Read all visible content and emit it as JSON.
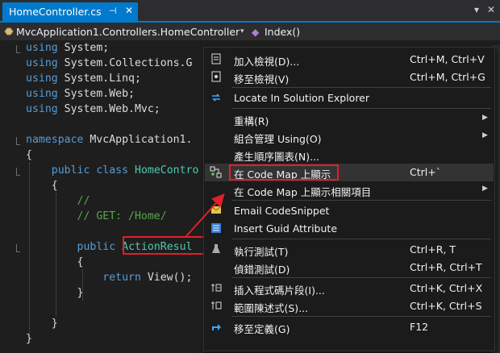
{
  "tab": {
    "title": "HomeController.cs",
    "pin": "⊣",
    "close": "✕"
  },
  "window_controls": {
    "dropdown": "▾",
    "close": "✕"
  },
  "navbar": {
    "class_path": "MvcApplication1.Controllers.HomeController",
    "member": "Index()",
    "dropdown": "▾"
  },
  "code_lines": [
    {
      "parts": [
        [
          "kw",
          "using"
        ],
        [
          "t",
          " System;"
        ]
      ]
    },
    {
      "parts": [
        [
          "kw",
          "using"
        ],
        [
          "t",
          " System.Collections.G"
        ]
      ]
    },
    {
      "parts": [
        [
          "kw",
          "using"
        ],
        [
          "t",
          " System.Linq;"
        ]
      ]
    },
    {
      "parts": [
        [
          "kw",
          "using"
        ],
        [
          "t",
          " System.Web;"
        ]
      ]
    },
    {
      "parts": [
        [
          "kw",
          "using"
        ],
        [
          "t",
          " System.Web.Mvc;"
        ]
      ]
    },
    {
      "parts": []
    },
    {
      "parts": [
        [
          "kw",
          "namespace"
        ],
        [
          "t",
          " MvcApplication1."
        ]
      ]
    },
    {
      "parts": [
        [
          "t",
          "{"
        ]
      ]
    },
    {
      "parts": [
        [
          "t",
          "    "
        ],
        [
          "kw",
          "public"
        ],
        [
          "t",
          " "
        ],
        [
          "kw",
          "class"
        ],
        [
          "t",
          " "
        ],
        [
          "ty",
          "HomeContro"
        ]
      ]
    },
    {
      "parts": [
        [
          "t",
          "    {"
        ]
      ]
    },
    {
      "parts": [
        [
          "t",
          "        "
        ],
        [
          "cm",
          "//"
        ]
      ]
    },
    {
      "parts": [
        [
          "t",
          "        "
        ],
        [
          "cm",
          "// GET: /Home/"
        ]
      ]
    },
    {
      "parts": []
    },
    {
      "parts": [
        [
          "t",
          "        "
        ],
        [
          "kw",
          "public"
        ],
        [
          "t",
          " "
        ],
        [
          "ty",
          "ActionResul"
        ]
      ]
    },
    {
      "parts": [
        [
          "t",
          "        {"
        ]
      ]
    },
    {
      "parts": [
        [
          "t",
          "            "
        ],
        [
          "kw",
          "return"
        ],
        [
          "t",
          " View();"
        ]
      ]
    },
    {
      "parts": [
        [
          "t",
          "        }"
        ]
      ]
    },
    {
      "parts": []
    },
    {
      "parts": [
        [
          "t",
          "    }"
        ]
      ]
    },
    {
      "parts": [
        [
          "t",
          "}"
        ]
      ]
    }
  ],
  "colors": {
    "keyword": "#569cd6",
    "type": "#4ec9b0",
    "comment": "#57a64a",
    "accent": "#007acc",
    "highlight": "#e0202a"
  },
  "menu": {
    "items": [
      {
        "icon": "add-view-icon",
        "label": "加入檢視(D)...",
        "shortcut": "Ctrl+M, Ctrl+V",
        "submenu": false
      },
      {
        "icon": "goto-view-icon",
        "label": "移至檢視(V)",
        "shortcut": "Ctrl+M, Ctrl+G",
        "submenu": false
      },
      {
        "separator": true
      },
      {
        "icon": "locate-solution-icon",
        "label": "Locate In Solution Explorer",
        "shortcut": "",
        "submenu": false
      },
      {
        "separator": true
      },
      {
        "icon": "",
        "label": "重構(R)",
        "shortcut": "",
        "submenu": true
      },
      {
        "icon": "",
        "label": "組合管理 Using(O)",
        "shortcut": "",
        "submenu": true
      },
      {
        "icon": "",
        "label": "產生順序圖表(N)...",
        "shortcut": "",
        "submenu": false
      },
      {
        "icon": "code-map-icon",
        "label": "在 Code Map 上顯示",
        "shortcut": "Ctrl+`",
        "submenu": false,
        "active": true
      },
      {
        "icon": "",
        "label": "在 Code Map 上顯示相關項目",
        "shortcut": "",
        "submenu": true
      },
      {
        "separator": true
      },
      {
        "icon": "email-icon",
        "label": "Email CodeSnippet",
        "shortcut": "",
        "submenu": false
      },
      {
        "icon": "guid-icon",
        "label": "Insert Guid Attribute",
        "shortcut": "",
        "submenu": false
      },
      {
        "separator": true
      },
      {
        "icon": "run-tests-icon",
        "label": "執行測試(T)",
        "shortcut": "Ctrl+R, T",
        "submenu": false
      },
      {
        "icon": "",
        "label": "偵錯測試(D)",
        "shortcut": "Ctrl+R, Ctrl+T",
        "submenu": false
      },
      {
        "separator": true
      },
      {
        "icon": "insert-snippet-icon",
        "label": "插入程式碼片段(I)...",
        "shortcut": "Ctrl+K, Ctrl+X",
        "submenu": false
      },
      {
        "icon": "surround-with-icon",
        "label": "範圍陳述式(S)...",
        "shortcut": "Ctrl+K, Ctrl+S",
        "submenu": false
      },
      {
        "separator": true
      },
      {
        "icon": "goto-definition-icon",
        "label": "移至定義(G)",
        "shortcut": "F12",
        "submenu": false
      }
    ]
  }
}
